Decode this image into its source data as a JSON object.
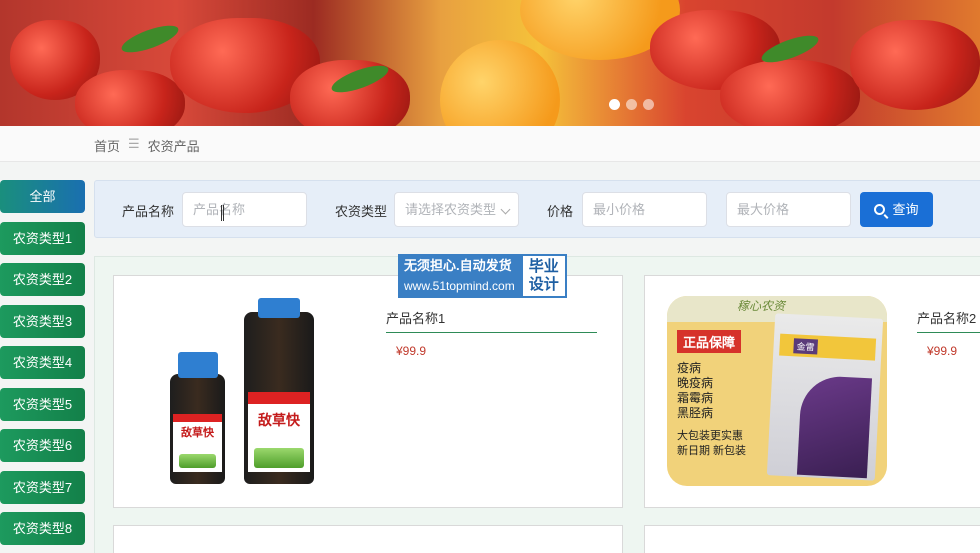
{
  "banner": {
    "slides": 3,
    "active_slide": 1
  },
  "breadcrumb": {
    "home": "首页",
    "separator": "☰",
    "current": "农资产品"
  },
  "sidebar": {
    "items": [
      {
        "label": "全部",
        "active": true
      },
      {
        "label": "农资类型1"
      },
      {
        "label": "农资类型2"
      },
      {
        "label": "农资类型3"
      },
      {
        "label": "农资类型4"
      },
      {
        "label": "农资类型5"
      },
      {
        "label": "农资类型6"
      },
      {
        "label": "农资类型7"
      },
      {
        "label": "农资类型8"
      }
    ]
  },
  "search": {
    "name_label": "产品名称",
    "name_placeholder": "产品名称",
    "type_label": "农资类型",
    "type_placeholder": "请选择农资类型",
    "price_label": "价格",
    "min_price_placeholder": "最小价格",
    "max_price_placeholder": "最大价格",
    "query_label": "查询"
  },
  "products": [
    {
      "name": "产品名称1",
      "price": "¥99.9",
      "image_text": "敌草快"
    },
    {
      "name": "产品名称2",
      "price": "¥99.9",
      "image_header": "稼心农资",
      "image_tag": "正品保障",
      "image_lines": [
        "疫病",
        "晚疫病",
        "霜霉病",
        "黑胫病"
      ],
      "image_footer": [
        "大包装更实惠",
        "新日期 新包装"
      ],
      "image_brand": "金雷"
    }
  ],
  "watermark": {
    "line1": "无须担心.自动发货",
    "line2": "www.51topmind.com",
    "badge": "毕业设计"
  },
  "colors": {
    "sidebar": "#138049",
    "primary_button": "#1a6fd6",
    "price": "#c0392b"
  }
}
